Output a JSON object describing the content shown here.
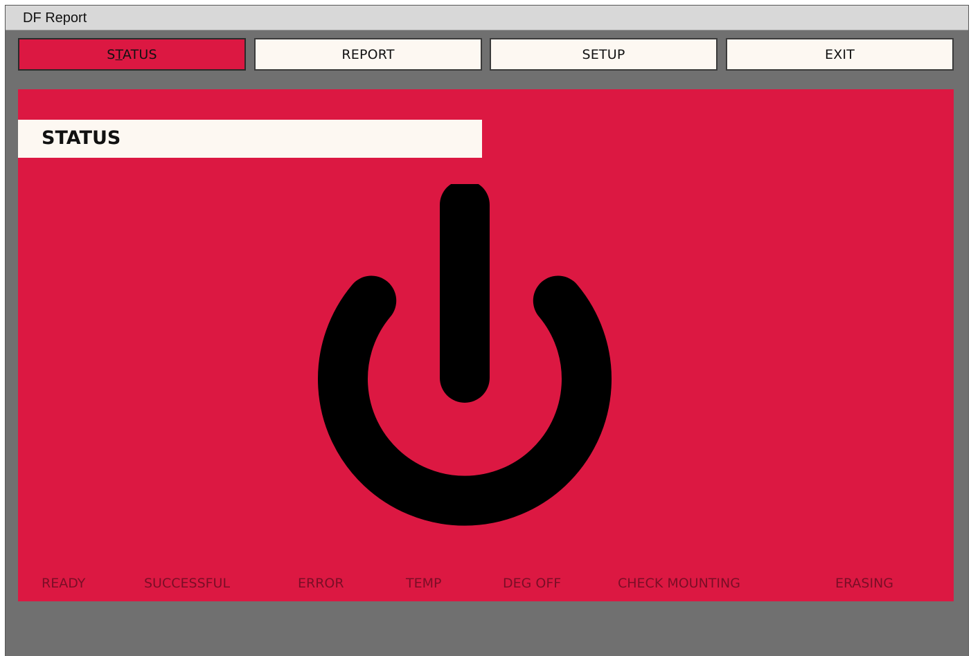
{
  "window": {
    "title": "DF Report"
  },
  "nav": {
    "buttons": [
      {
        "label_pre": "S",
        "label_ul": "T",
        "label_post": "ATUS",
        "active": true
      },
      {
        "label": "REPORT",
        "active": false
      },
      {
        "label": "SETUP",
        "active": false
      },
      {
        "label": "EXIT",
        "active": false
      }
    ]
  },
  "panel": {
    "header": "STATUS",
    "icon": "power-icon",
    "status_labels": [
      "READY",
      "SUCCESSFUL",
      "ERROR",
      "TEMP",
      "DEG OFF",
      "CHECK MOUNTING",
      "ERASING"
    ]
  },
  "colors": {
    "accent": "#dc1842",
    "button_bg": "#fdf8f2",
    "window_bg": "#707070",
    "titlebar_bg": "#d8d8d8",
    "inactive_status_text": "#7a0e26",
    "icon": "#000000"
  }
}
